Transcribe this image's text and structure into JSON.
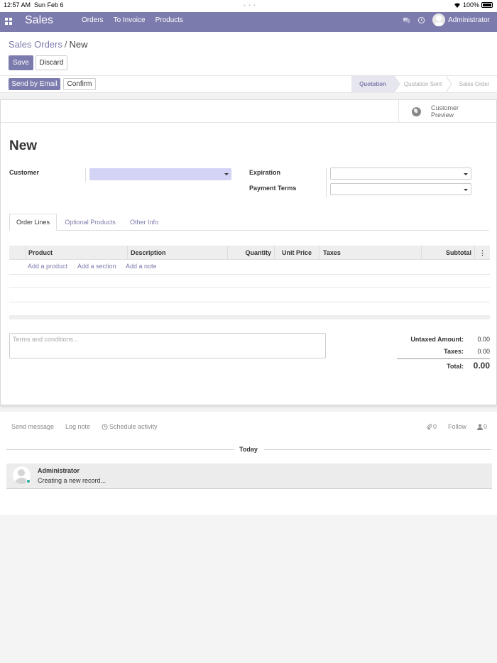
{
  "status_bar": {
    "time": "12:57 AM",
    "date": "Sun Feb 6",
    "battery": "100%"
  },
  "navbar": {
    "brand": "Sales",
    "menu": [
      "Orders",
      "To Invoice",
      "Products"
    ],
    "user": "Administrator"
  },
  "breadcrumb": {
    "parent": "Sales Orders",
    "separator": "/",
    "current": "New"
  },
  "buttons": {
    "save": "Save",
    "discard": "Discard",
    "send_by_email": "Send by Email",
    "confirm": "Confirm"
  },
  "stages": [
    "Quotation",
    "Quotation Sent",
    "Sales Order"
  ],
  "active_stage": "Quotation",
  "smart_button": {
    "label_line1": "Customer",
    "label_line2": "Preview"
  },
  "form": {
    "title": "New",
    "customer_label": "Customer",
    "customer_value": "",
    "expiration_label": "Expiration",
    "payment_terms_label": "Payment Terms"
  },
  "tabs": [
    "Order Lines",
    "Optional Products",
    "Other Info"
  ],
  "table": {
    "headers": [
      "Product",
      "Description",
      "Quantity",
      "Unit Price",
      "Taxes",
      "Subtotal"
    ],
    "links": [
      "Add a product",
      "Add a section",
      "Add a note"
    ]
  },
  "terms_placeholder": "Terms and conditions...",
  "totals": {
    "untaxed_label": "Untaxed Amount:",
    "untaxed_value": "0.00",
    "taxes_label": "Taxes:",
    "taxes_value": "0.00",
    "total_label": "Total:",
    "total_value": "0.00"
  },
  "chatter": {
    "send_message": "Send message",
    "log_note": "Log note",
    "schedule_activity": "Schedule activity",
    "attachments_count": "0",
    "follow": "Follow",
    "followers_count": "0",
    "date_separator": "Today",
    "message_author": "Administrator",
    "message_body": "Creating a new record..."
  },
  "colors": {
    "primary": "#7c7bad",
    "customer_field_bg": "#d2d3f5",
    "online": "#1ea99b"
  }
}
